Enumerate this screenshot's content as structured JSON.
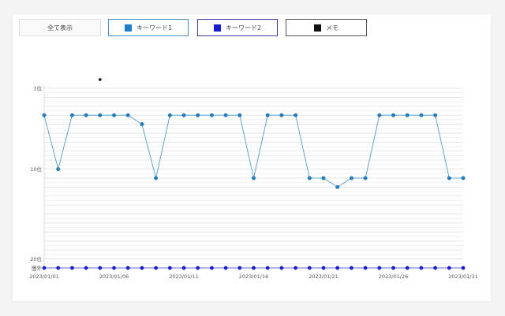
{
  "buttons": {
    "all": {
      "label": "全て表示"
    },
    "keyword1": {
      "label": "キーワード1",
      "color": "#1f7fc4"
    },
    "keyword2": {
      "label": "キーワード2",
      "color": "#1a1ad0"
    },
    "memo": {
      "label": "メモ",
      "color": "#111111"
    }
  },
  "chart_data": {
    "type": "line",
    "x": [
      "2023/01/01",
      "2023/01/02",
      "2023/01/03",
      "2023/01/04",
      "2023/01/05",
      "2023/01/06",
      "2023/01/07",
      "2023/01/08",
      "2023/01/09",
      "2023/01/10",
      "2023/01/11",
      "2023/01/12",
      "2023/01/13",
      "2023/01/14",
      "2023/01/15",
      "2023/01/16",
      "2023/01/17",
      "2023/01/18",
      "2023/01/19",
      "2023/01/20",
      "2023/01/21",
      "2023/01/22",
      "2023/01/23",
      "2023/01/24",
      "2023/01/25",
      "2023/01/26",
      "2023/01/27",
      "2023/01/28",
      "2023/01/29",
      "2023/01/30",
      "2023/01/31"
    ],
    "x_tick_labels": [
      "2023/01/01",
      "2023/01/06",
      "2023/01/11",
      "2023/01/16",
      "2023/01/21",
      "2023/01/26",
      "2023/01/31"
    ],
    "y_tick_labels": [
      {
        "label": "1位",
        "value": 1
      },
      {
        "label": "10位",
        "value": 10
      },
      {
        "label": "20位",
        "value": 20
      },
      {
        "label": "圏外",
        "value": 21
      }
    ],
    "y_reversed": true,
    "ylim": [
      1,
      21
    ],
    "grid": true,
    "series": [
      {
        "name": "キーワード1",
        "color": "#1f7fc4",
        "values": [
          4,
          10,
          4,
          4,
          4,
          4,
          4,
          5,
          11,
          4,
          4,
          4,
          4,
          4,
          4,
          11,
          4,
          4,
          4,
          11,
          11,
          12,
          11,
          11,
          4,
          4,
          4,
          4,
          4,
          11,
          11
        ]
      },
      {
        "name": "キーワード2",
        "color": "#1a1ad0",
        "values": [
          21,
          21,
          21,
          21,
          21,
          21,
          21,
          21,
          21,
          21,
          21,
          21,
          21,
          21,
          21,
          21,
          21,
          21,
          21,
          21,
          21,
          21,
          21,
          21,
          21,
          21,
          21,
          21,
          21,
          21,
          21
        ]
      }
    ],
    "memo_markers": [
      {
        "x": "2023/01/05"
      }
    ]
  }
}
